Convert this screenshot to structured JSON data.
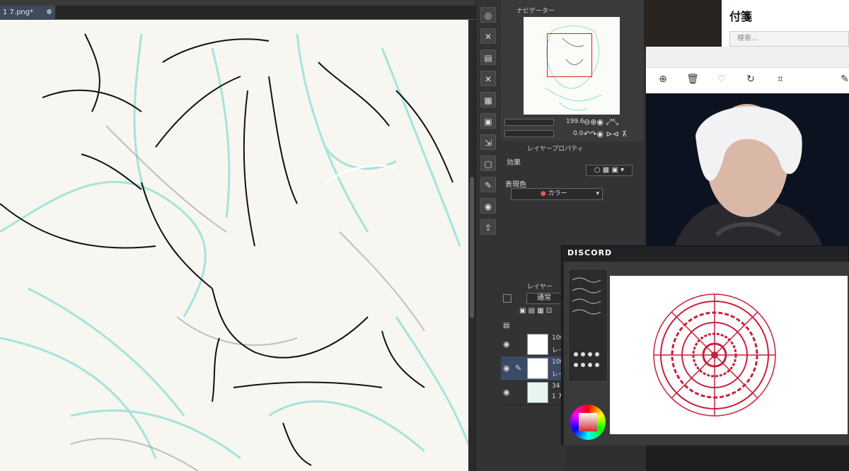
{
  "document": {
    "tab_title": "1 7.png*"
  },
  "command_bar": {
    "icons": [
      "zoom-icon",
      "close-x-icon",
      "file-icon",
      "close-x-icon",
      "grid-icon",
      "save-icon",
      "export-icon",
      "frame-icon",
      "edit-icon",
      "camera-icon",
      "export-person-icon"
    ]
  },
  "navigator": {
    "tab_label": "ナビゲーター",
    "zoom_value": "199.6",
    "rotate_value": "0.0"
  },
  "layer_property": {
    "tab_label": "レイヤープロパティ",
    "effect_label": "効果",
    "expression_color_label": "表現色",
    "expression_color_value": "カラー"
  },
  "layers": {
    "tab_label": "レイヤー",
    "blend_mode": "通常",
    "rows": [
      {
        "opacity": "100",
        "name": "レイ"
      },
      {
        "opacity": "100",
        "name": "レイ"
      },
      {
        "opacity": "34",
        "name": "1 7"
      }
    ]
  },
  "fusen": {
    "title": "付箋",
    "search_placeholder": "検索..."
  },
  "viewer": {
    "tools": [
      "zoom-in-icon",
      "delete-icon",
      "heart-icon",
      "rotate-icon",
      "crop-icon",
      "edit-icon"
    ]
  },
  "discord": {
    "logo": "DISCORD"
  },
  "colors": {
    "accent_red": "#d62020",
    "sketch_cyan": "#8ee0d6",
    "canvas_bg": "#f8f6f1",
    "mandala_red": "#c8203c"
  }
}
